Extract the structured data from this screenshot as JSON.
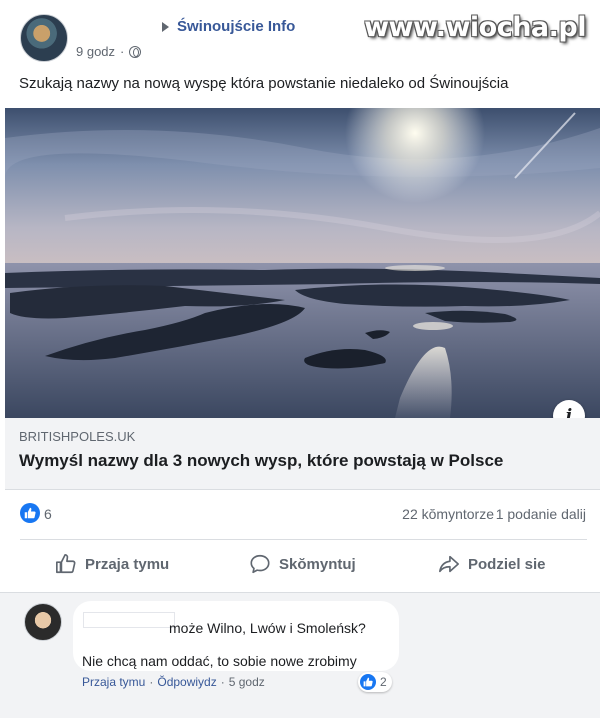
{
  "post": {
    "page_name": "Świnoujście Info",
    "time": "9 godz",
    "dot": "·",
    "text": "Szukają nazwy na nową wyspę która powstanie niedaleko od Świnoujścia",
    "watermark": "www.wiocha.pl"
  },
  "link": {
    "domain": "BRITISHPOLES.UK",
    "title": "Wymyśl nazwy dla 3 nowych wysp, które powstają w Polsce",
    "info_glyph": "i"
  },
  "stats": {
    "reactions": "6",
    "comments": "22 kŏmyntorze",
    "shares": "1 podanie dalij"
  },
  "actions": {
    "like": "Przaja tymu",
    "comment": "Skŏmyntuj",
    "share": "Podziel sie"
  },
  "comment": {
    "text_line1": "może Wilno, Lwów i Smoleńsk?",
    "text_line2": "Nie chcą nam oddać, to sobie nowe zrobimy",
    "reactions": "2",
    "like_action": "Przaja tymu",
    "reply_action": "Ŏdpowiydz",
    "time": "5 godz",
    "dot": "·"
  },
  "colors": {
    "accent": "#385898",
    "like_blue": "#1877f2",
    "muted": "#606770"
  },
  "icons": [
    "play-icon",
    "globe-icon",
    "info-icon",
    "like-bubble-icon",
    "thumbs-up-icon",
    "comment-icon",
    "share-icon"
  ]
}
